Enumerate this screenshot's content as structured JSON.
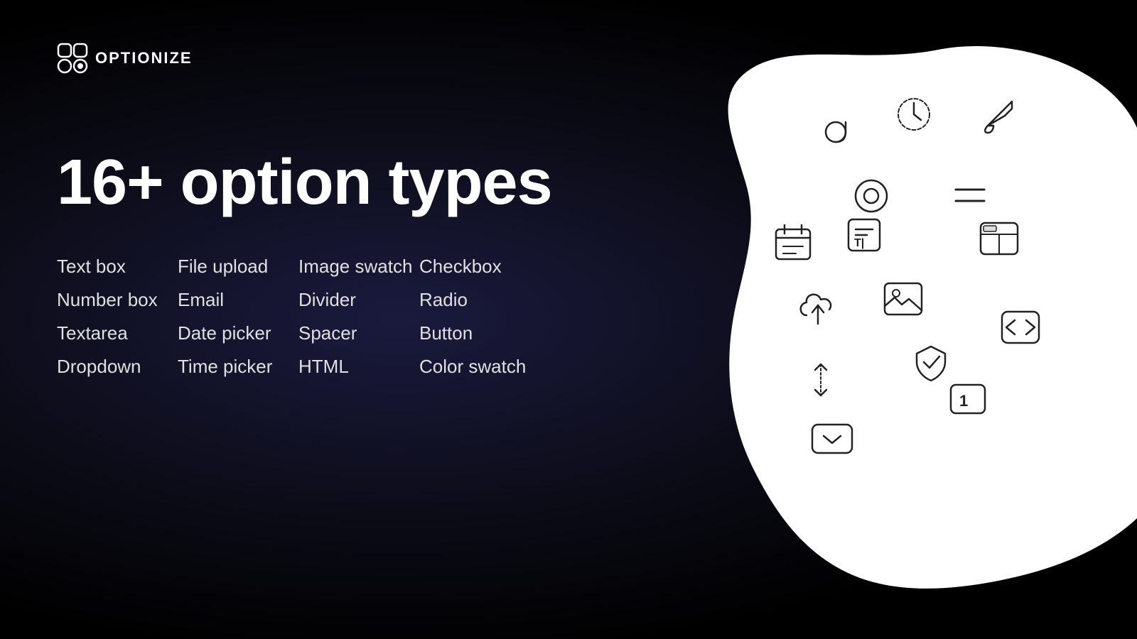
{
  "logo": {
    "text": "OPTIONIZE"
  },
  "heading": {
    "line1": "16+ option types"
  },
  "options": {
    "col1": [
      "Text box",
      "Number box",
      "Textarea",
      "Dropdown"
    ],
    "col2": [
      "File upload",
      "Email",
      "Date picker",
      "Time picker"
    ],
    "col3": [
      "Image swatch",
      "Divider",
      "Spacer",
      "HTML"
    ],
    "col4": [
      "Checkbox",
      "Radio",
      "Button",
      "Color swatch"
    ]
  },
  "colors": {
    "background": "#000000",
    "accent": "#1a1a3e",
    "text": "#ffffff",
    "blob": "#ffffff",
    "icon_stroke": "#1a1a1a"
  }
}
